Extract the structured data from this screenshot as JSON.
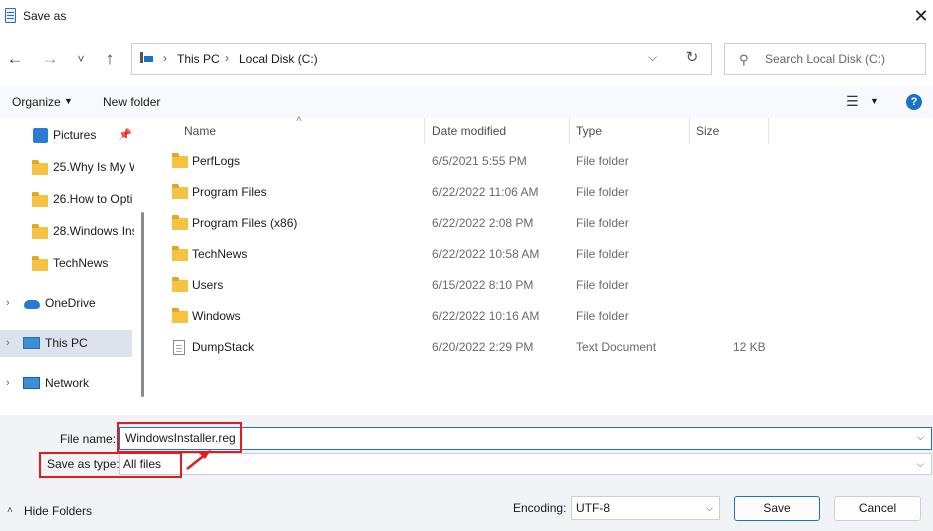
{
  "window": {
    "title": "Save as",
    "close_glyph": "✕"
  },
  "nav": {
    "back_glyph": "←",
    "forward_glyph": "→",
    "recent_glyph": "˅",
    "up_glyph": "↑",
    "refresh_glyph": "↻",
    "dropdown_glyph": "⌵",
    "crumb_sep": "›",
    "breadcrumb": [
      "This PC",
      "Local Disk (C:)"
    ],
    "search_placeholder": "Search Local Disk (C:)",
    "search_glyph": "⚲"
  },
  "toolbar": {
    "organize_label": "Organize",
    "newfolder_label": "New folder",
    "views_glyph": "☰",
    "arrow_glyph": "▼",
    "help_glyph": "?"
  },
  "sidebar": {
    "expand_glyph": "›",
    "pin_glyph": "📌",
    "items": [
      {
        "label": "Pictures",
        "icon": "pictures-icon"
      },
      {
        "label": "25.Why Is My W",
        "icon": "folder-icon"
      },
      {
        "label": "26.How to Opti",
        "icon": "folder-icon"
      },
      {
        "label": "28.Windows Ins",
        "icon": "folder-icon"
      },
      {
        "label": "TechNews",
        "icon": "folder-icon"
      },
      {
        "label": "OneDrive",
        "icon": "cloud-icon"
      },
      {
        "label": "This PC",
        "icon": "pc-icon"
      },
      {
        "label": "Network",
        "icon": "network-icon"
      }
    ]
  },
  "file_list": {
    "sort_glyph": "˄",
    "columns": [
      "Name",
      "Date modified",
      "Type",
      "Size"
    ],
    "rows": [
      {
        "name": "PerfLogs",
        "date": "6/5/2021 5:55 PM",
        "type": "File folder",
        "size": "",
        "icon": "folder-icon"
      },
      {
        "name": "Program Files",
        "date": "6/22/2022 11:06 AM",
        "type": "File folder",
        "size": "",
        "icon": "folder-icon"
      },
      {
        "name": "Program Files (x86)",
        "date": "6/22/2022 2:08 PM",
        "type": "File folder",
        "size": "",
        "icon": "folder-icon"
      },
      {
        "name": "TechNews",
        "date": "6/22/2022 10:58 AM",
        "type": "File folder",
        "size": "",
        "icon": "folder-icon"
      },
      {
        "name": "Users",
        "date": "6/15/2022 8:10 PM",
        "type": "File folder",
        "size": "",
        "icon": "folder-icon"
      },
      {
        "name": "Windows",
        "date": "6/22/2022 10:16 AM",
        "type": "File folder",
        "size": "",
        "icon": "folder-icon"
      },
      {
        "name": "DumpStack",
        "date": "6/20/2022 2:29 PM",
        "type": "Text Document",
        "size": "12 KB",
        "icon": "text-document-icon"
      }
    ]
  },
  "save_form": {
    "filename_label": "File name:",
    "filename_value": "WindowsInstaller.reg",
    "savetype_label": "Save as type:",
    "savetype_value": "All files",
    "dropdown_glyph": "⌵"
  },
  "footer": {
    "hide_folders_glyph": "˄",
    "hide_folders_label": "Hide Folders",
    "encoding_label": "Encoding:",
    "encoding_value": "UTF-8",
    "save_label": "Save",
    "cancel_label": "Cancel"
  },
  "colors": {
    "accent": "#1a73c9",
    "folder": "#f5c242",
    "annotation": "#e11d1d",
    "selected_bg": "#dce3ec"
  }
}
